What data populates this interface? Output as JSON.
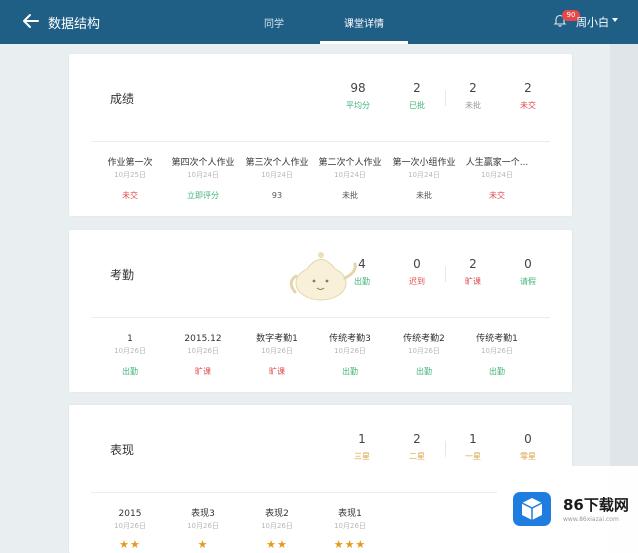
{
  "header": {
    "course_title": "数据结构",
    "tabs": [
      {
        "label": "同学"
      },
      {
        "label": "课堂详情"
      }
    ],
    "notification_count": "90",
    "user_name": "周小白",
    "colors": {
      "bar": "#1f5f86"
    }
  },
  "scores": {
    "title": "成绩",
    "stats": [
      {
        "value": "98",
        "label": "平均分"
      },
      {
        "value": "2",
        "label": "已批"
      },
      {
        "value": "2",
        "label": "未批"
      },
      {
        "value": "2",
        "label": "未交"
      }
    ],
    "items": [
      {
        "name": "作业第一次",
        "date": "10月25日",
        "status": "未交"
      },
      {
        "name": "第四次个人作业",
        "date": "10月24日",
        "status": "立即评分"
      },
      {
        "name": "第三次个人作业",
        "date": "10月24日",
        "status": "93"
      },
      {
        "name": "第二次个人作业",
        "date": "10月24日",
        "status": "未批"
      },
      {
        "name": "第一次小组作业",
        "date": "10月24日",
        "status": "未批"
      },
      {
        "name": "人生赢家一个...",
        "date": "10月24日",
        "status": "未交"
      }
    ]
  },
  "attendance": {
    "title": "考勤",
    "stats": [
      {
        "value": "4",
        "label": "出勤"
      },
      {
        "value": "0",
        "label": "迟到"
      },
      {
        "value": "2",
        "label": "旷课"
      },
      {
        "value": "0",
        "label": "请假"
      }
    ],
    "items": [
      {
        "name": "1",
        "date": "10月26日",
        "status": "出勤"
      },
      {
        "name": "2015.12",
        "date": "10月26日",
        "status": "旷课"
      },
      {
        "name": "数字考勤1",
        "date": "10月26日",
        "status": "旷课"
      },
      {
        "name": "传统考勤3",
        "date": "10月26日",
        "status": "出勤"
      },
      {
        "name": "传统考勤2",
        "date": "10月26日",
        "status": "出勤"
      },
      {
        "name": "传统考勤1",
        "date": "10月26日",
        "status": "出勤"
      }
    ]
  },
  "performance": {
    "title": "表现",
    "stats": [
      {
        "value": "1",
        "label": "三星"
      },
      {
        "value": "2",
        "label": "二星"
      },
      {
        "value": "1",
        "label": "一星"
      },
      {
        "value": "0",
        "label": "零星"
      }
    ],
    "items": [
      {
        "name": "2015",
        "date": "10月26日",
        "stars": "★★"
      },
      {
        "name": "表现3",
        "date": "10月26日",
        "stars": "★"
      },
      {
        "name": "表现2",
        "date": "10月26日",
        "stars": "★★"
      },
      {
        "name": "表现1",
        "date": "10月26日",
        "stars": "★★★"
      }
    ]
  },
  "watermark": {
    "brand": "86下载网",
    "url": "www.86xiazai.com"
  }
}
